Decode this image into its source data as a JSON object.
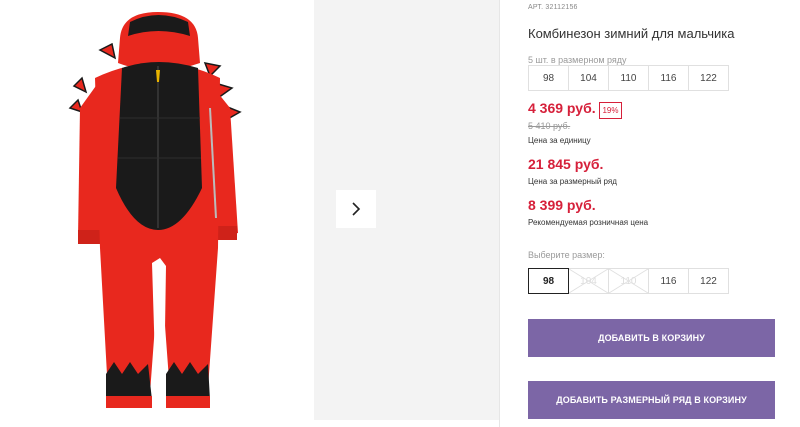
{
  "product": {
    "article": "АРТ. 32112156",
    "title": "Комбинезон зимний для мальчика",
    "row_count": "5 шт. в размерном ряду"
  },
  "size_row": [
    "98",
    "104",
    "110",
    "116",
    "122"
  ],
  "prices": {
    "unit_price": "4 369 руб.",
    "discount": "19%",
    "old_price": "5 410 руб.",
    "unit_caption": "Цена за единицу",
    "row_price": "21 845 руб.",
    "row_caption": "Цена за размерный ряд",
    "rrp_price": "8 399 руб.",
    "rrp_caption": "Рекомендуемая розничная цена"
  },
  "size_select": {
    "label": "Выберите размер:",
    "options": [
      {
        "label": "98",
        "state": "selected"
      },
      {
        "label": "104",
        "state": "disabled"
      },
      {
        "label": "110",
        "state": "disabled"
      },
      {
        "label": "116",
        "state": "available"
      },
      {
        "label": "122",
        "state": "available"
      }
    ]
  },
  "buttons": {
    "add_to_cart": "ДОБАВИТЬ В КОРЗИНУ",
    "add_row_to_cart": "ДОБАВИТЬ РАЗМЕРНЫЙ РЯД В КОРЗИНУ"
  },
  "colors": {
    "price_red": "#d6203a",
    "button_purple": "#7c66a6",
    "suit_red": "#e8281e",
    "suit_black": "#1a1a1a"
  },
  "icons": {
    "next": "chevron-right-icon"
  }
}
